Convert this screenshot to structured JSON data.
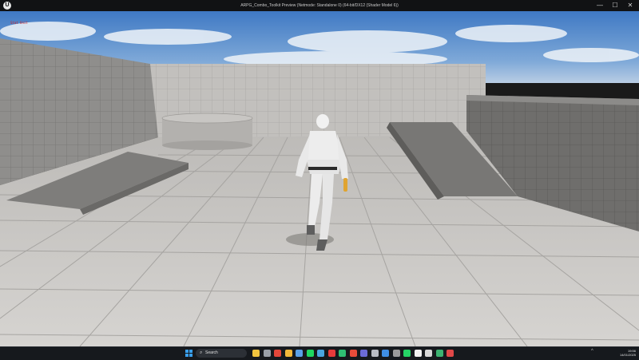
{
  "window": {
    "title": "ARPG_Combo_Toolkit Preview (Netmode: Standalone 0)  (64-bit/DX12 (Shader Model 6))",
    "minimize_glyph": "—",
    "maximize_glyph": "☐",
    "close_glyph": "✕",
    "logo_glyph": "U"
  },
  "viewport": {
    "debug_text": "Stat Unit",
    "sky_color": "#5b8fce",
    "floor_color": "#c9c7c4",
    "wall_color": "#8d8c8a"
  },
  "taskbar": {
    "search_placeholder": "Search",
    "search_icon": "magnifier-icon",
    "apps": [
      {
        "name": "file-explorer-icon",
        "color": "#f1c33e"
      },
      {
        "name": "task-view-icon",
        "color": "#9aa0a8"
      },
      {
        "name": "chrome-icon",
        "color": "#e4473a"
      },
      {
        "name": "folder-icon",
        "color": "#f3b83a"
      },
      {
        "name": "app-icon",
        "color": "#5aa0e8"
      },
      {
        "name": "spotify-icon",
        "color": "#1ed760"
      },
      {
        "name": "app-icon",
        "color": "#4aa5e0"
      },
      {
        "name": "app-icon",
        "color": "#e63b3b"
      },
      {
        "name": "app-icon",
        "color": "#2fbf73"
      },
      {
        "name": "app-icon",
        "color": "#e94c3a"
      },
      {
        "name": "app-icon",
        "color": "#6b6bd8"
      },
      {
        "name": "app-icon",
        "color": "#b8bcc4"
      },
      {
        "name": "app-icon",
        "color": "#3f8fe6"
      },
      {
        "name": "app-icon",
        "color": "#9c9c9c"
      },
      {
        "name": "whatsapp-icon",
        "color": "#25d366"
      },
      {
        "name": "unreal-engine-icon",
        "color": "#f2f2f2"
      },
      {
        "name": "unreal-engine-icon",
        "color": "#d8d8d8"
      },
      {
        "name": "app-icon",
        "color": "#3cb371"
      },
      {
        "name": "app-icon",
        "color": "#e04848"
      }
    ],
    "time": "19:56",
    "date": "14/01/2025",
    "tray_caret": "^"
  }
}
